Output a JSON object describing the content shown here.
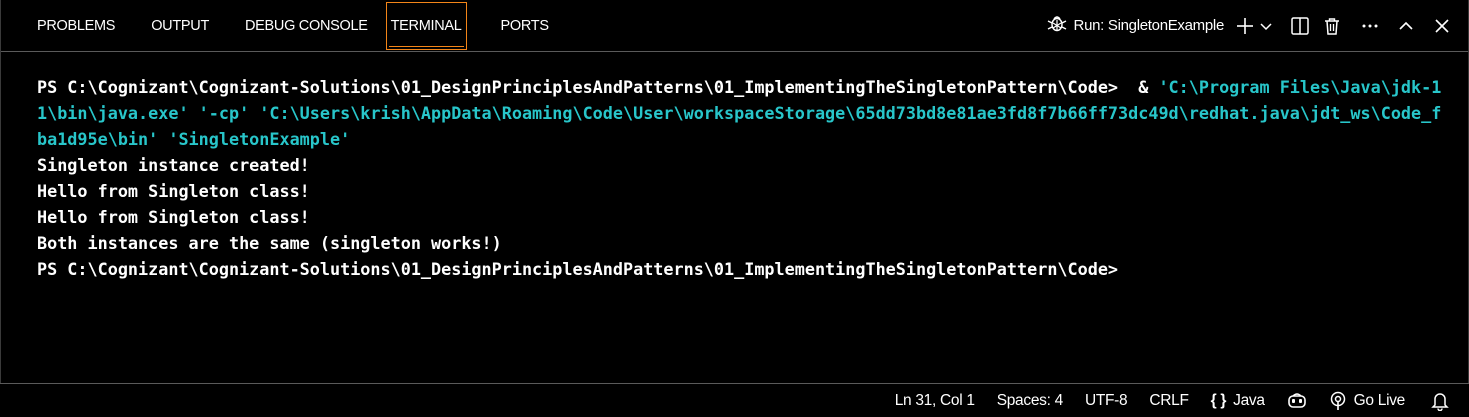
{
  "tabs": [
    {
      "label": "PROBLEMS"
    },
    {
      "label": "OUTPUT"
    },
    {
      "label": "DEBUG CONSOLE"
    },
    {
      "label": "TERMINAL"
    },
    {
      "label": "PORTS"
    }
  ],
  "active_tab": "TERMINAL",
  "run_target": {
    "label": "Run: SingletonExample",
    "icon": "debug-icon"
  },
  "actions": [
    {
      "icon": "plus-icon"
    },
    {
      "icon": "chevron-down-icon"
    },
    {
      "icon": "split-icon"
    },
    {
      "icon": "trash-icon"
    },
    {
      "icon": "ellipsis-icon"
    },
    {
      "icon": "chevron-up-icon"
    },
    {
      "icon": "close-icon"
    }
  ],
  "terminal": {
    "prompt1": "PS C:\\Cognizant\\Cognizant-Solutions\\01_DesignPrinciplesAndPatterns\\01_ImplementingTheSingletonPattern\\Code>  & ",
    "command": "'C:\\Program Files\\Java\\jdk-11\\bin\\java.exe' '-cp' 'C:\\Users\\krish\\AppData\\Roaming\\Code\\User\\workspaceStorage\\65dd73bd8e81ae3fd8f7b66ff73dc49d\\redhat.java\\jdt_ws\\Code_fba1d95e\\bin' 'SingletonExample'",
    "output": [
      "Singleton instance created!",
      "Hello from Singleton class!",
      "Hello from Singleton class!",
      "Both instances are the same (singleton works!)"
    ],
    "prompt2": "PS C:\\Cognizant\\Cognizant-Solutions\\01_DesignPrinciplesAndPatterns\\01_ImplementingTheSingletonPattern\\Code>"
  },
  "statusbar": {
    "position": "Ln 31, Col 1",
    "spaces": "Spaces: 4",
    "encoding": "UTF-8",
    "eol": "CRLF",
    "language": "Java",
    "golive": "Go Live"
  },
  "colors": {
    "background": "#000000",
    "accent": "#f38518",
    "command": "#28c6ca",
    "border": "#5a5a5a"
  }
}
